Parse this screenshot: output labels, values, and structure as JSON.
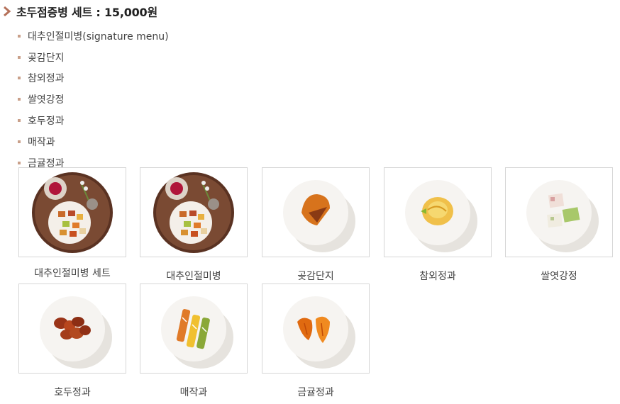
{
  "set_title": "초두점증병 세트 : 15,000원",
  "menu_items": [
    "대추인절미병(signature menu)",
    "곶감단지",
    "참외정과",
    "쌀엿강정",
    "호두정과",
    "매작과",
    "금귤정과"
  ],
  "gallery": [
    {
      "label": "대추인절미병 세트",
      "image": "tray-set-photo"
    },
    {
      "label": "대추인절미병",
      "image": "tray-set-photo"
    },
    {
      "label": "곶감단지",
      "image": "dried-persimmon-photo"
    },
    {
      "label": "참외정과",
      "image": "melon-candy-photo"
    },
    {
      "label": "쌀엿강정",
      "image": "rice-gangjeong-photo"
    },
    {
      "label": "호두정과",
      "image": "walnut-candy-photo"
    },
    {
      "label": "매작과",
      "image": "maejakgwa-photo"
    },
    {
      "label": "금귤정과",
      "image": "kumquat-candy-photo"
    }
  ],
  "colors": {
    "accent_chevron": "#b5715a",
    "bullet": "#c9a08a",
    "border": "#d6d6d6"
  }
}
